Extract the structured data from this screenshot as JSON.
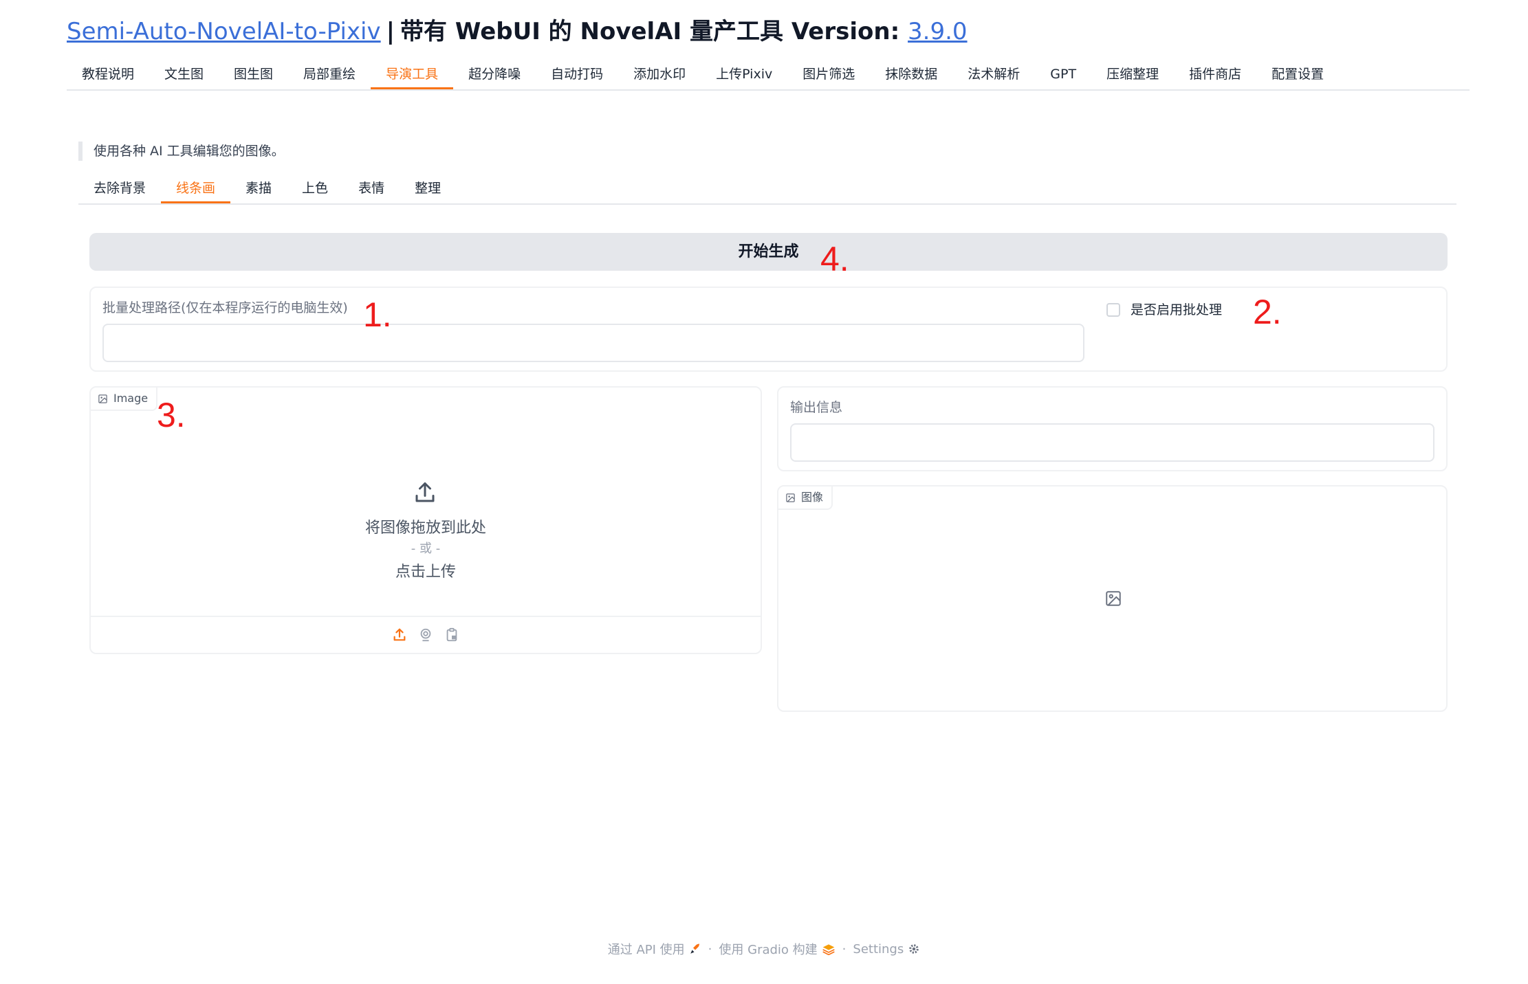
{
  "header": {
    "link_title": "Semi-Auto-NovelAI-to-Pixiv",
    "separator": "|",
    "subtitle": "带有 WebUI 的 NovelAI 量产工具 Version:",
    "version": "3.9.0"
  },
  "main_tabs": [
    {
      "label": "教程说明"
    },
    {
      "label": "文生图"
    },
    {
      "label": "图生图"
    },
    {
      "label": "局部重绘"
    },
    {
      "label": "导演工具",
      "active": true
    },
    {
      "label": "超分降噪"
    },
    {
      "label": "自动打码"
    },
    {
      "label": "添加水印"
    },
    {
      "label": "上传Pixiv"
    },
    {
      "label": "图片筛选"
    },
    {
      "label": "抹除数据"
    },
    {
      "label": "法术解析"
    },
    {
      "label": "GPT"
    },
    {
      "label": "压缩整理"
    },
    {
      "label": "插件商店"
    },
    {
      "label": "配置设置"
    }
  ],
  "description": "使用各种 AI 工具编辑您的图像。",
  "sub_tabs": [
    {
      "label": "去除背景"
    },
    {
      "label": "线条画",
      "active": true
    },
    {
      "label": "素描"
    },
    {
      "label": "上色"
    },
    {
      "label": "表情"
    },
    {
      "label": "整理"
    }
  ],
  "generate_button": "开始生成",
  "annotations": {
    "a1": "1.",
    "a2": "2.",
    "a3": "3.",
    "a4": "4."
  },
  "batch": {
    "label": "批量处理路径(仅在本程序运行的电脑生效)",
    "value": "",
    "checkbox_label": "是否启用批处理",
    "checked": false
  },
  "image_input": {
    "tag": "Image",
    "drop_text": "将图像拖放到此处",
    "or_text": "- 或 -",
    "click_text": "点击上传"
  },
  "output": {
    "info_label": "输出信息",
    "info_value": "",
    "image_tag": "图像"
  },
  "footer": {
    "api": "通过 API 使用",
    "gradio": "使用 Gradio 构建",
    "settings": "Settings",
    "dot": "·"
  },
  "colors": {
    "accent": "#f97316",
    "link": "#3b6fd8",
    "annotation": "#ee1c1c"
  }
}
